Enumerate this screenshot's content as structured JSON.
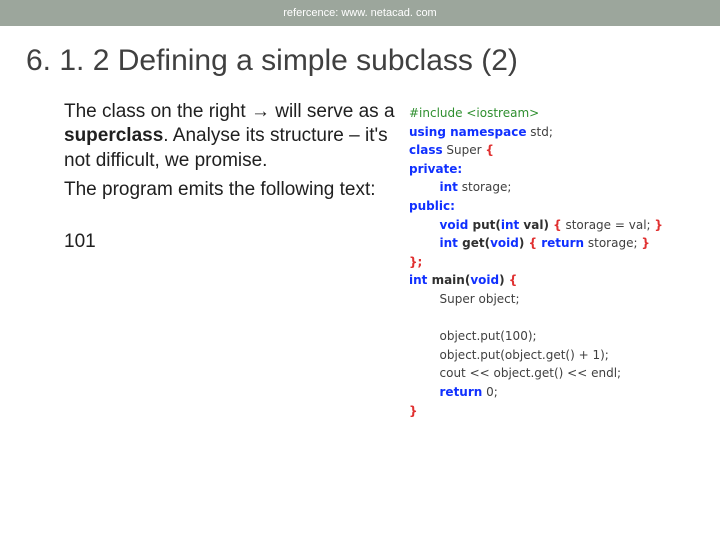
{
  "header": {
    "ref": "refercence: www. netacad. com"
  },
  "title": "6. 1. 2 Defining a simple subclass (2)",
  "body": {
    "p1_a": "The class on the right ",
    "p1_arrow": "→",
    "p1_b": " will serve as a ",
    "p1_strong": "superclass",
    "p1_c": ". Analyse its structure – it's not difficult, we promise.",
    "p2": "The program emits the following text:",
    "output": "101"
  },
  "code": {
    "l01_a": "#include",
    "l01_b": " <iostream>",
    "l02_a": "using namespace",
    "l02_b": " std;",
    "l03_a": "class",
    "l03_b": " Super ",
    "l03_c": "{",
    "l04": "private:",
    "l05_a": "int",
    "l05_b": " storage;",
    "l06": "public:",
    "l07_a": "void",
    "l07_b": " put(",
    "l07_c": "int",
    "l07_d": " val) ",
    "l07_e": "{",
    "l07_f": " storage = val; ",
    "l07_g": "}",
    "l08_a": "int",
    "l08_b": " get(",
    "l08_c": "void",
    "l08_d": ") ",
    "l08_e": "{",
    "l08_f": " return",
    "l08_g": " storage; ",
    "l08_h": "}",
    "l09": "};",
    "l10_a": "int",
    "l10_b": " main(",
    "l10_c": "void",
    "l10_d": ") ",
    "l10_e": "{",
    "l11": "Super object;",
    "l12": "object.put(100);",
    "l13": "object.put(object.get() + 1);",
    "l14": "cout << object.get() << endl;",
    "l15_a": "return",
    "l15_b": " 0;",
    "l16": "}",
    "indent1": "        ",
    "indent2": "                "
  }
}
